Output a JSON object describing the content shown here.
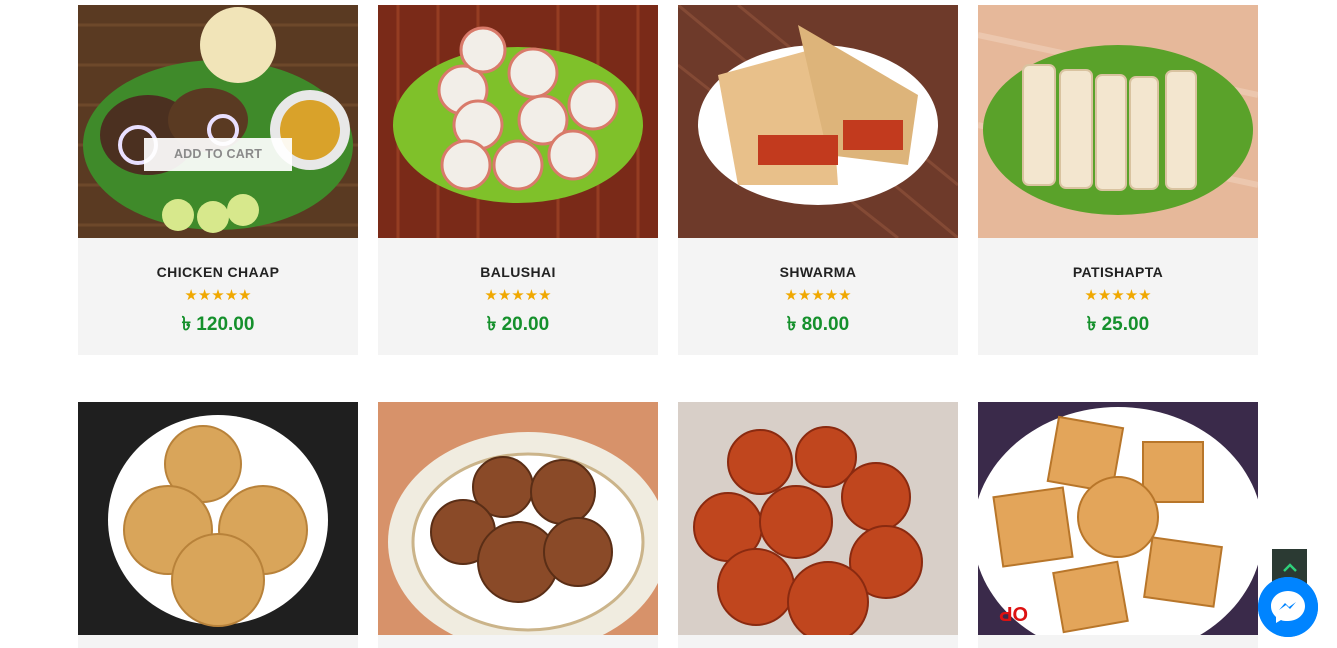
{
  "products": [
    {
      "name": "CHICKEN CHAAP",
      "rating": "★★★★★",
      "price": "৳ 120.00",
      "add_to_cart": "ADD TO CART"
    },
    {
      "name": "BALUSHAI",
      "rating": "★★★★★",
      "price": "৳ 20.00"
    },
    {
      "name": "SHWARMA",
      "rating": "★★★★★",
      "price": "৳ 80.00"
    },
    {
      "name": "PATISHAPTA",
      "rating": "★★★★★",
      "price": "৳ 25.00"
    }
  ],
  "bottom_row": [
    {
      "image": "samosa-plate"
    },
    {
      "image": "cutlet-plate"
    },
    {
      "image": "gulab-jamun-plate"
    },
    {
      "image": "sandesh-plate",
      "image_text": "OP"
    }
  ],
  "icons": {
    "scroll_top": "chevron-up-icon",
    "chat": "messenger-icon"
  },
  "colors": {
    "price": "#15902c",
    "stars": "#f0a800",
    "chat": "#0084ff",
    "scroll_top_bg": "#2b3a33"
  }
}
